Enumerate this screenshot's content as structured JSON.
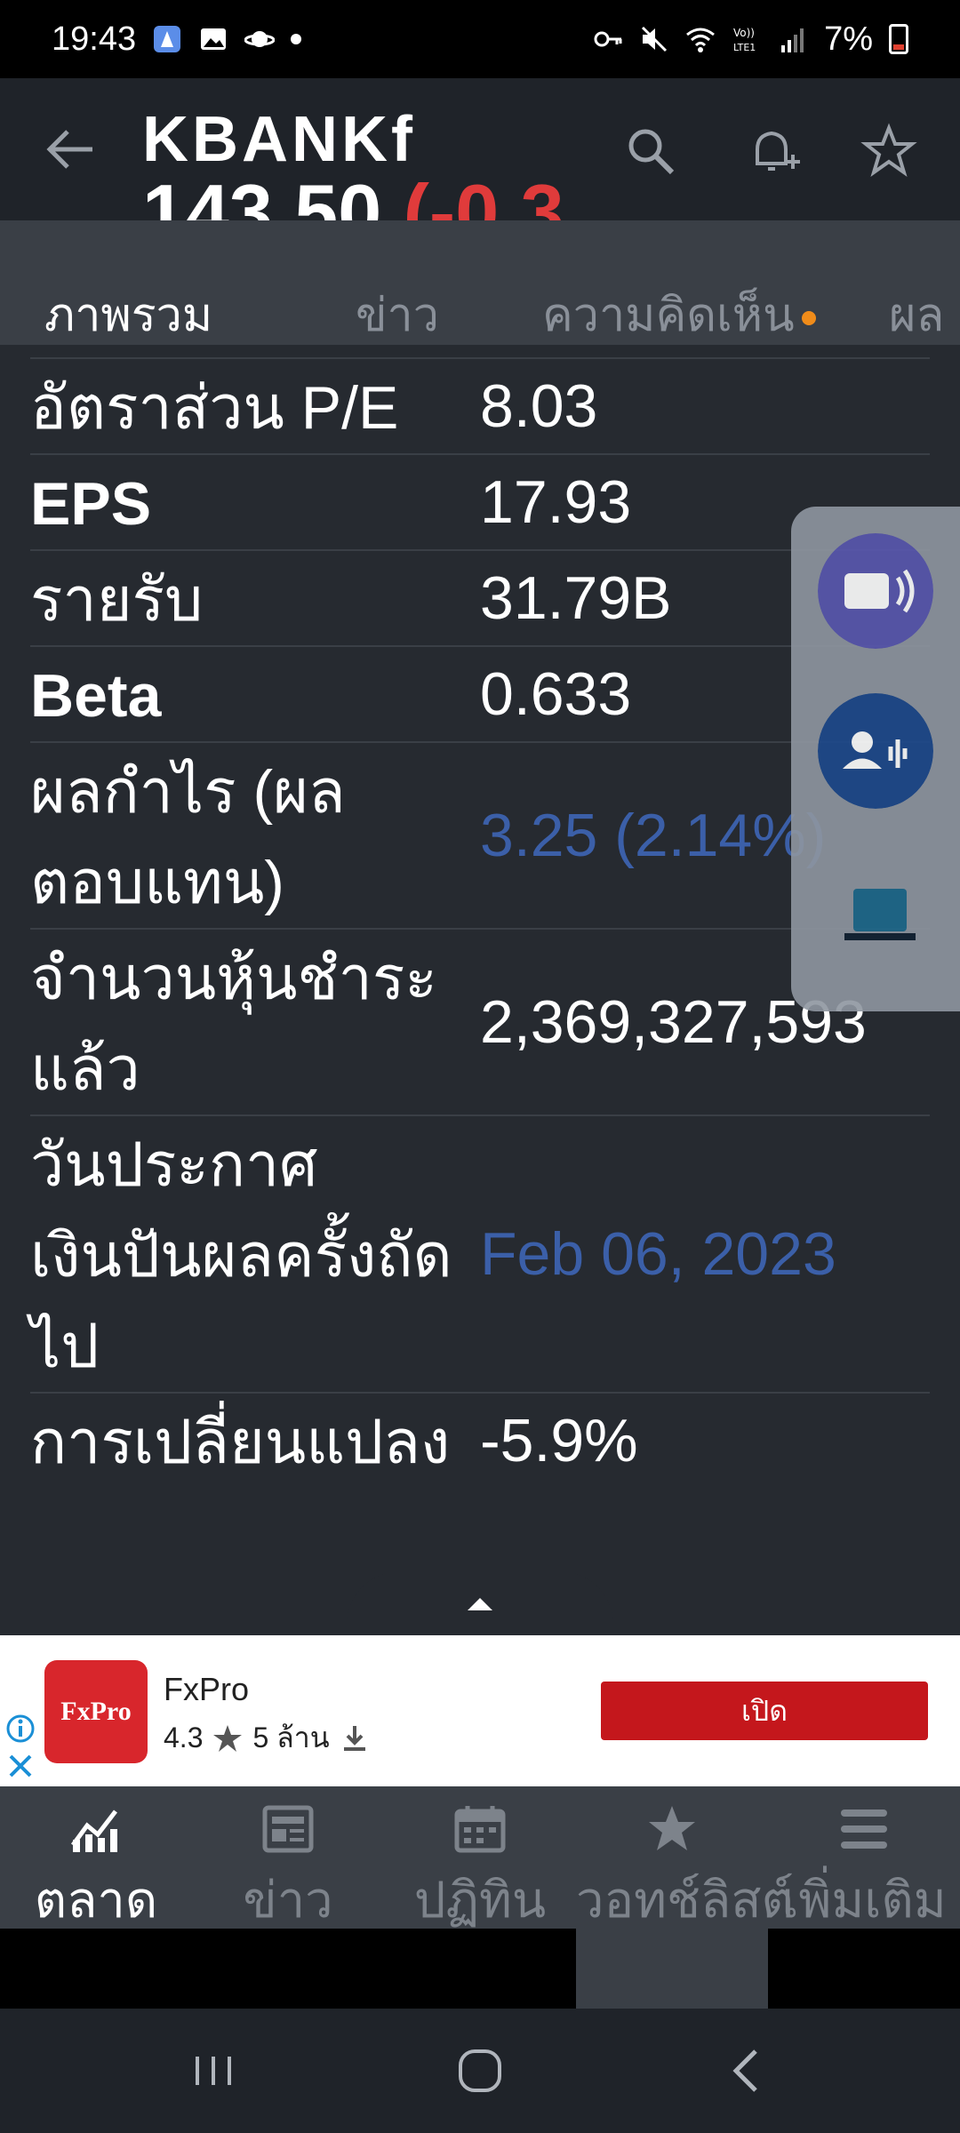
{
  "status_bar": {
    "time": "19:43",
    "battery": "7%"
  },
  "header": {
    "symbol": "KBANKf",
    "price": "143.50",
    "change": "(-0.3"
  },
  "tabs": [
    {
      "label": "ภาพรวม",
      "active": true
    },
    {
      "label": "ข่าว",
      "active": false
    },
    {
      "label": "ความคิดเห็น",
      "active": false,
      "dot": true
    },
    {
      "label": "ผล",
      "active": false
    }
  ],
  "stats": [
    {
      "label": "อัตราส่วน P/E",
      "value": "8.03",
      "bold_label": false,
      "link": false
    },
    {
      "label": "EPS",
      "value": "17.93",
      "bold_label": true,
      "link": false
    },
    {
      "label": "รายรับ",
      "value": "31.79B",
      "bold_label": false,
      "link": false
    },
    {
      "label": "Beta",
      "value": "0.633",
      "bold_label": true,
      "link": false
    },
    {
      "label": "ผลกำไร (ผลตอบแทน)",
      "value": "3.25 (2.14%)",
      "bold_label": false,
      "link": true
    },
    {
      "label": "จำนวนหุ้นชำระแล้ว",
      "value": "2,369,327,593",
      "bold_label": false,
      "link": false
    },
    {
      "label": "วันประกาศเงินปันผลครั้งถัดไป",
      "value": "Feb 06, 2023",
      "bold_label": false,
      "link": true
    },
    {
      "label": "การเปลี่ยนแปลง",
      "value": "-5.9%",
      "bold_label": false,
      "link": false
    }
  ],
  "ad": {
    "logo_text": "FxPro",
    "name": "FxPro",
    "rating": "4.3",
    "downloads": "5 ล้าน",
    "open_label": "เปิด"
  },
  "bottom_nav": [
    {
      "label": "ตลาด",
      "icon": "chart-icon",
      "active": true
    },
    {
      "label": "ข่าว",
      "icon": "news-icon",
      "active": false
    },
    {
      "label": "ปฏิทิน",
      "icon": "calendar-icon",
      "active": false
    },
    {
      "label": "วอทช์ลิสต์",
      "icon": "star-icon",
      "active": false
    },
    {
      "label": "เพิ่มเติม",
      "icon": "menu-icon",
      "active": false
    }
  ],
  "colors": {
    "background": "#262a30",
    "header": "#1f2329",
    "negative": "#e03b3b",
    "link": "#3b5fa8",
    "ad_button": "#c4171c"
  }
}
